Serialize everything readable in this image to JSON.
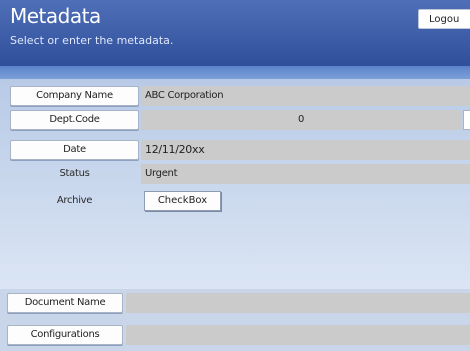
{
  "header": {
    "title": "Metadata",
    "subtitle": "Select or enter the metadata.",
    "logout_label": "Logou"
  },
  "rows": {
    "company_name": {
      "label": "Company Name",
      "value": "ABC Corporation"
    },
    "dept_code": {
      "label": "Dept.Code",
      "value": "0"
    },
    "date": {
      "label": "Date",
      "value": "12/11/20xx"
    },
    "status": {
      "label": "Status",
      "value": "Urgent"
    },
    "archive": {
      "label": "Archive",
      "button": "CheckBox"
    }
  },
  "bottom": {
    "document_name": {
      "label": "Document Name",
      "value": ""
    },
    "configurations": {
      "label": "Configurations",
      "value": ""
    }
  },
  "colors": {
    "header_top": "#4f6fb8",
    "header_bottom": "#2f4f9b",
    "field_bg": "#cbcbcb",
    "panel_bg": "#c4d3ea"
  }
}
